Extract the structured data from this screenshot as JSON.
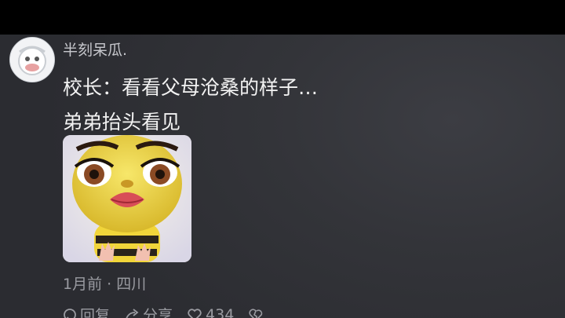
{
  "comment": {
    "username": "半刻呆瓜.",
    "lines": [
      "校长：看看父母沧桑的样子…",
      "弟弟抬头看见"
    ],
    "meta": "1月前 · 四川"
  },
  "actions": {
    "reply_label": "回复",
    "share_label": "分享",
    "like_count": "434"
  },
  "icons": [
    "avatar",
    "bee-sticker-image",
    "reply-icon",
    "share-icon",
    "heart-icon",
    "broken-heart-icon"
  ]
}
